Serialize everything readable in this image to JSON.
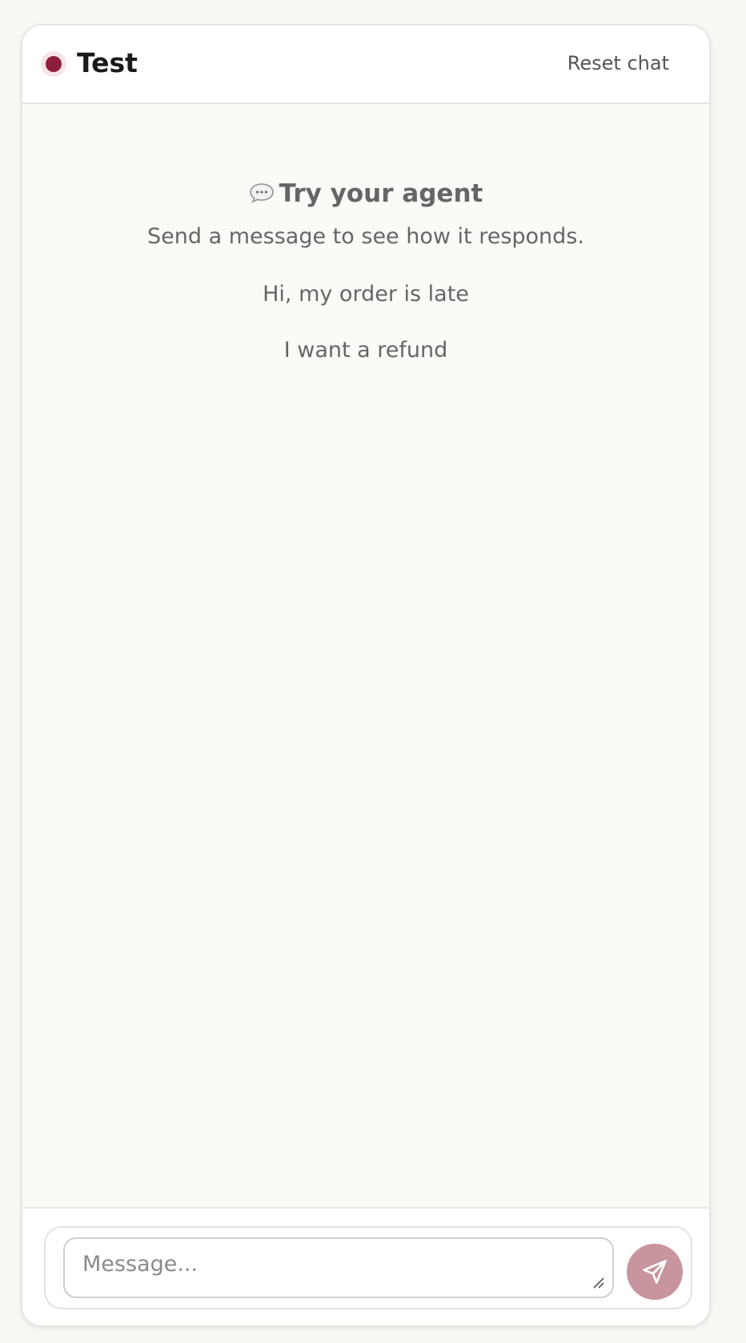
{
  "header": {
    "agent_name": "Test",
    "status_color": "#8e1f3a",
    "reset_label": "Reset chat"
  },
  "empty_state": {
    "icon": "speech-bubble-icon",
    "title": "Try your agent",
    "subtitle": "Send a message to see how it responds.",
    "suggestions": [
      "Hi, my order is late",
      "I want a refund"
    ]
  },
  "composer": {
    "placeholder": "Message...",
    "value": "",
    "send_icon": "send-icon",
    "send_color": "#c8949d"
  }
}
